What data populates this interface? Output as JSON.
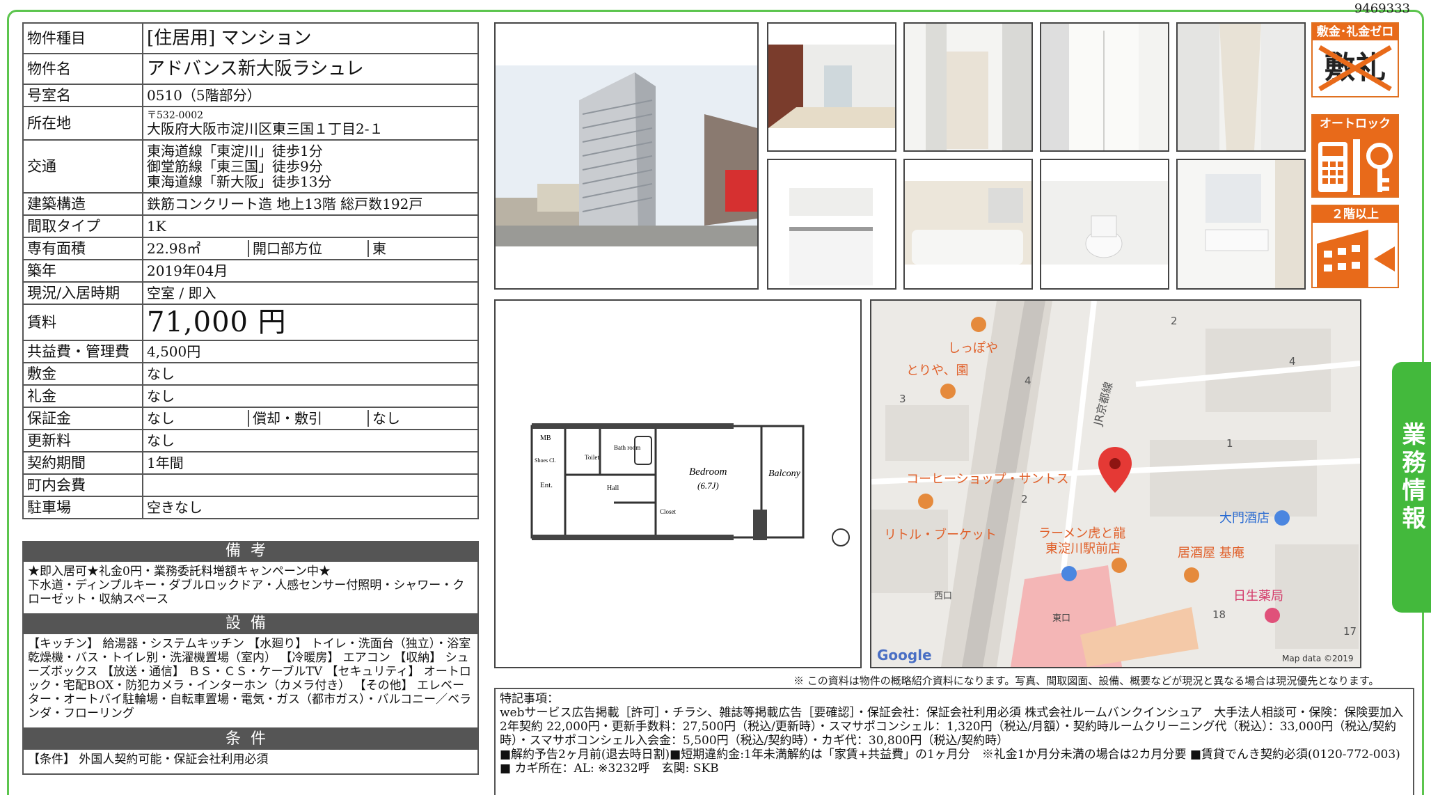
{
  "doc_id": "9469333",
  "rows": {
    "type": {
      "label": "物件種目",
      "value": "[住居用]  マンション"
    },
    "name": {
      "label": "物件名",
      "value": "アドバンス新大阪ラシュレ"
    },
    "room": {
      "label": "号室名",
      "value": "0510（5階部分）"
    },
    "address": {
      "label": "所在地",
      "postal": "〒532-0002",
      "value": "大阪府大阪市淀川区東三国１丁目2-１"
    },
    "access": {
      "label": "交通",
      "lines": [
        "東海道線「東淀川」徒歩1分",
        "御堂筋線「東三国」徒歩9分",
        "東海道線「新大阪」徒歩13分"
      ]
    },
    "structure": {
      "label": "建築構造",
      "value": "鉄筋コンクリート造 地上13階 総戸数192戸"
    },
    "layout": {
      "label": "間取タイプ",
      "value": "1K"
    },
    "area": {
      "label": "専有面積",
      "value": "22.98㎡",
      "dir_label": "開口部方位",
      "dir_value": "東"
    },
    "built": {
      "label": "築年",
      "value": "2019年04月"
    },
    "status": {
      "label": "現況/入居時期",
      "value": "空室 / 即入"
    },
    "rent": {
      "label": "賃料",
      "value": "71,000 円"
    },
    "fee": {
      "label": "共益費・管理費",
      "value": "4,500円"
    },
    "deposit": {
      "label": "敷金",
      "value": "なし"
    },
    "key_money": {
      "label": "礼金",
      "value": "なし"
    },
    "guarantee": {
      "label": "保証金",
      "value": "なし",
      "amort_label": "償却・敷引",
      "amort_value": "なし"
    },
    "renewal": {
      "label": "更新料",
      "value": "なし"
    },
    "period": {
      "label": "契約期間",
      "value": "1年間"
    },
    "town_fee": {
      "label": "町内会費",
      "value": ""
    },
    "parking": {
      "label": "駐車場",
      "value": "空きなし"
    }
  },
  "bikou": {
    "title": "備考",
    "text": "★即入居可★礼金0円・業務委託料増額キャンペーン中★\n下水道・ディンプルキー・ダブルロックドア・人感センサー付照明・シャワー・クローゼット・収納スペース"
  },
  "setsubi": {
    "title": "設備",
    "text": "【キッチン】 給湯器・システムキッチン 【水廻り】 トイレ・洗面台（独立）・浴室乾燥機・バス・トイレ別・洗濯機置場（室内） 【冷暖房】 エアコン 【収納】 シューズボックス 【放送・通信】 ＢＳ・ＣＳ・ケーブルTV 【セキュリティ】 オートロック・宅配BOX・防犯カメラ・インターホン（カメラ付き） 【その他】 エレベーター・オートバイ駐輪場・自転車置場・電気・ガス（都市ガス）・バルコニー／ベランダ・フローリング"
  },
  "jouken": {
    "title": "条件",
    "text": "【条件】 外国人契約可能・保証会社利用必須"
  },
  "badges": {
    "b1": "敷金･礼金ゼロ",
    "b1_glyph": "敷礼",
    "b2": "オートロック",
    "b3": "２階以上"
  },
  "side_tab": "業務情報",
  "floorplan": {
    "mb": "MB",
    "shoes": "Shoes Cl.",
    "toilet": "Toilet",
    "bath": "Bath room",
    "ent": "Ent.",
    "hall": "Hall",
    "bedroom": "Bedroom",
    "bedroom_size": "(6.7J)",
    "balcony": "Balcony",
    "closet": "Closet"
  },
  "map": {
    "labels": [
      "しっぽや",
      "とりや、園",
      "コーヒーショップ・サントス",
      "リトル・ブーケット",
      "ラーメン虎と龍",
      "東淀川駅前店",
      "居酒屋 基庵",
      "大門酒店",
      "日生薬局",
      "JR京都線",
      "西口",
      "東口"
    ],
    "numbers": [
      "2",
      "4",
      "3",
      "1",
      "2",
      "4",
      "18",
      "17"
    ],
    "logo": "Google",
    "credit": "Map data ©2019"
  },
  "note": "※ この資料は物件の概略紹介資料になります。写真、間取図面、設備、概要などが現況と異なる場合は現況優先となります。",
  "remarks": {
    "lines": [
      "特記事項：",
      "webサービス広告掲載［許可］・チラシ、雑誌等掲載広告［要確認］・保証会社：保証会社利用必須 株式会社ルームバンクインシュア　大手法人相談可・保険：保険要加入 2年契約 22,000円・更新手数料：27,500円（税込/更新時）・スマサポコンシェル：1,320円（税込/月額）・契約時ルームクリーニング代（税込）：33,000円（税込/契約時）・スマサポコンシェル入会金：5,500円（税込/契約時）・カギ代：30,800円（税込/契約時）",
      "■解約予告2ヶ月前(退去時日割)■短期違約金:1年未満解約は「家賃+共益費」の1ヶ月分　※礼金1か月分未満の場合は2カ月分要 ■賃貸でんき契約必須(0120-772-003)",
      "■ カギ所在：AL: ※3232呼　玄関: SKB"
    ]
  }
}
